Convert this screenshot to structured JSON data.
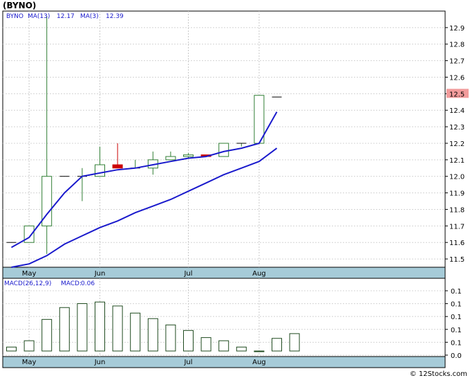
{
  "title": "(BYNO)",
  "credit": "© 12Stocks.com",
  "chart_data": [
    {
      "type": "candlestick",
      "legend": {
        "symbol": "BYNO",
        "ma13_label": "MA(13)",
        "ma13_value": "12.17",
        "ma3_label": "MA(3)",
        "ma3_value": "12.39"
      },
      "y_ticks": [
        "12.9",
        "12.8",
        "12.7",
        "12.6",
        "12.5",
        "12.4",
        "12.3",
        "12.2",
        "12.1",
        "12.0",
        "11.9",
        "11.8",
        "11.7",
        "11.6",
        "11.5"
      ],
      "ylim": [
        11.45,
        13.0
      ],
      "x_labels": [
        {
          "label": "May",
          "index": 1
        },
        {
          "label": "Jun",
          "index": 5
        },
        {
          "label": "Jul",
          "index": 10
        },
        {
          "label": "Aug",
          "index": 14
        }
      ],
      "current_price": "12.5",
      "candles": [
        {
          "o": 11.6,
          "h": 11.6,
          "l": 11.6,
          "c": 11.6
        },
        {
          "o": 11.6,
          "h": 11.7,
          "l": 11.6,
          "c": 11.7
        },
        {
          "o": 11.7,
          "h": 12.97,
          "l": 11.53,
          "c": 12.0
        },
        {
          "o": 12.0,
          "h": 12.0,
          "l": 12.0,
          "c": 12.0
        },
        {
          "o": 12.0,
          "h": 12.05,
          "l": 11.85,
          "c": 12.0
        },
        {
          "o": 12.0,
          "h": 12.18,
          "l": 12.0,
          "c": 12.07
        },
        {
          "o": 12.07,
          "h": 12.2,
          "l": 12.05,
          "c": 12.05
        },
        {
          "o": 12.05,
          "h": 12.1,
          "l": 12.05,
          "c": 12.05
        },
        {
          "o": 12.05,
          "h": 12.15,
          "l": 12.01,
          "c": 12.1
        },
        {
          "o": 12.1,
          "h": 12.15,
          "l": 12.1,
          "c": 12.12
        },
        {
          "o": 12.12,
          "h": 12.14,
          "l": 12.11,
          "c": 12.13
        },
        {
          "o": 12.13,
          "h": 12.13,
          "l": 12.12,
          "c": 12.12
        },
        {
          "o": 12.12,
          "h": 12.2,
          "l": 12.12,
          "c": 12.2
        },
        {
          "o": 12.2,
          "h": 12.2,
          "l": 12.18,
          "c": 12.2
        },
        {
          "o": 12.2,
          "h": 12.49,
          "l": 12.2,
          "c": 12.49
        },
        {
          "o": 12.48,
          "h": 12.48,
          "l": 12.48,
          "c": 12.48
        }
      ],
      "ma3": [
        11.57,
        11.63,
        11.77,
        11.9,
        12.0,
        12.02,
        12.04,
        12.05,
        12.07,
        12.09,
        12.11,
        12.12,
        12.15,
        12.17,
        12.2,
        12.39
      ],
      "ma13": [
        11.45,
        11.47,
        11.52,
        11.59,
        11.64,
        11.69,
        11.73,
        11.78,
        11.82,
        11.86,
        11.91,
        11.96,
        12.01,
        12.05,
        12.09,
        12.17
      ]
    },
    {
      "type": "bar",
      "legend": {
        "label": "MACD(26,12,9)",
        "value_label": "MACD:",
        "value": "0.06"
      },
      "y_ticks": [
        "0.1",
        "0.1",
        "0.1",
        "0.1",
        "0.1",
        "0.0"
      ],
      "ylim": [
        -0.007,
        0.092
      ],
      "x_labels": [
        {
          "label": "May",
          "index": 1
        },
        {
          "label": "Jun",
          "index": 5
        },
        {
          "label": "Jul",
          "index": 10
        },
        {
          "label": "Aug",
          "index": 14
        }
      ],
      "values": [
        0.005,
        0.013,
        0.04,
        0.055,
        0.06,
        0.062,
        0.057,
        0.048,
        0.041,
        0.033,
        0.026,
        0.017,
        0.013,
        0.005,
        0.0,
        0.016,
        0.022
      ]
    }
  ],
  "colors": {
    "up_candle": "#2e7d32",
    "down_candle": "#cc0000",
    "ma": "#1a1acc",
    "macd_bar": "#1e4a1e",
    "axis_band": "#a6cbd8",
    "price_tag": "#f29b9b"
  }
}
